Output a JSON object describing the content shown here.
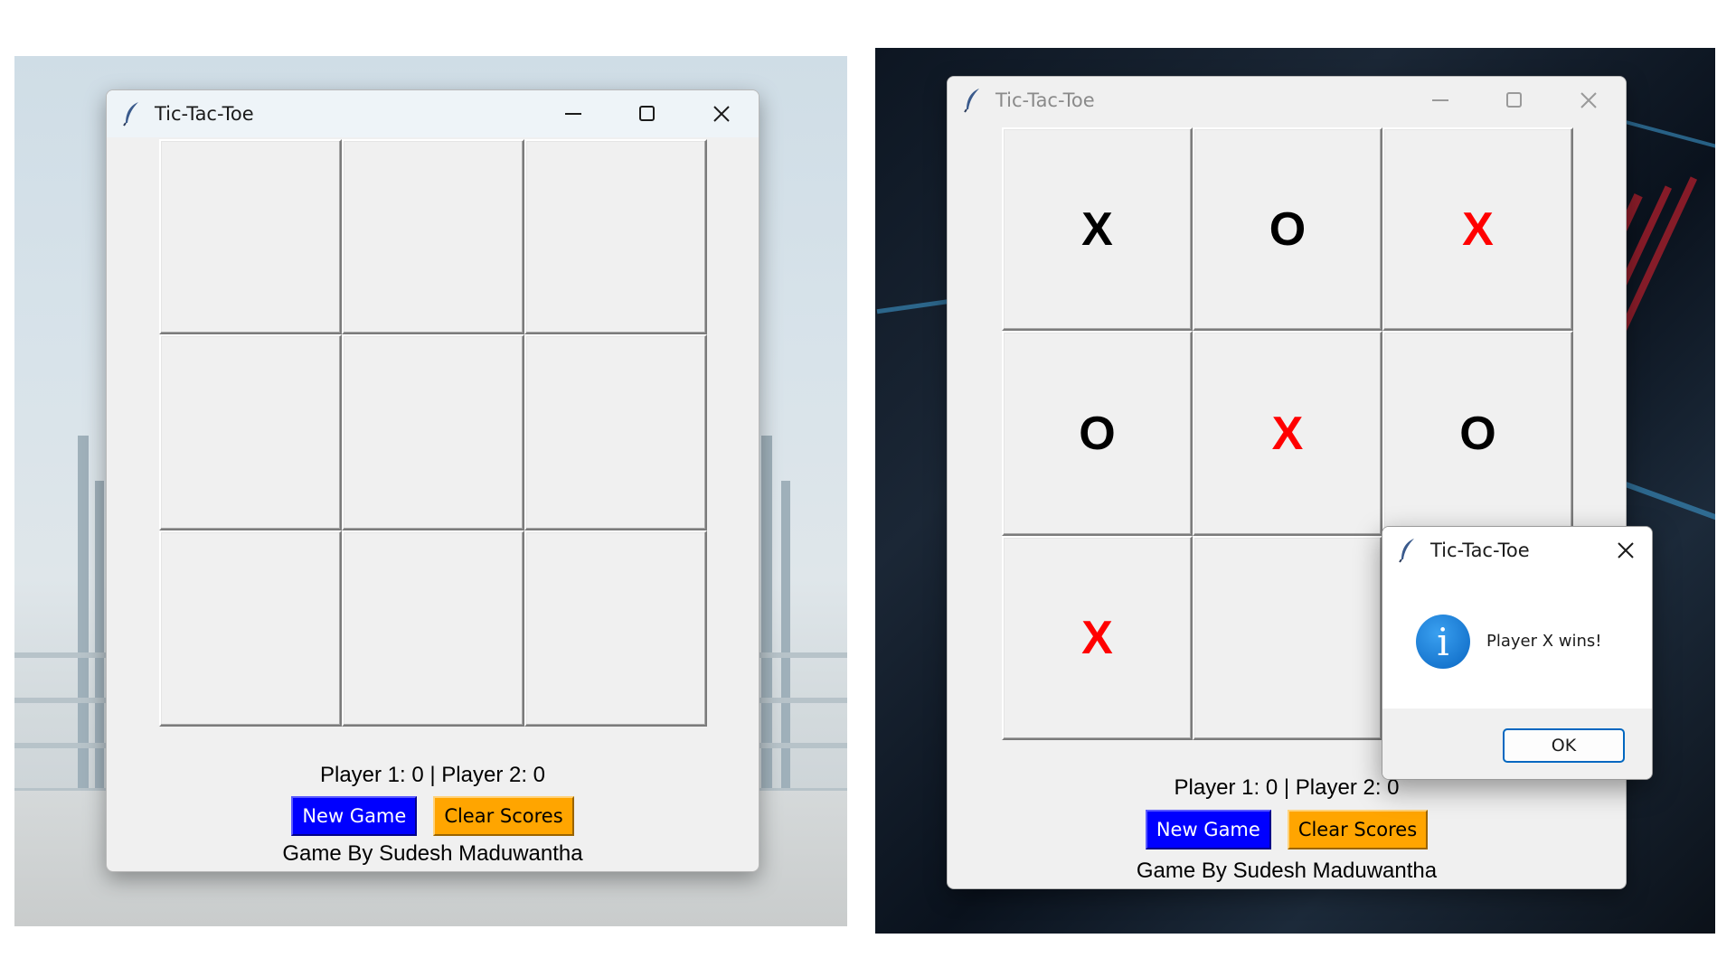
{
  "left_window": {
    "title": "Tic-Tac-Toe",
    "cells": [
      "",
      "",
      "",
      "",
      "",
      "",
      "",
      "",
      ""
    ],
    "score_text": "Player 1: 0 | Player 2: 0",
    "new_game_label": "New Game",
    "clear_scores_label": "Clear Scores",
    "credit": "Game By Sudesh Maduwantha",
    "icons": {
      "app": "feather-icon",
      "minimize": "minimize-icon",
      "maximize": "maximize-icon",
      "close": "close-icon"
    }
  },
  "right_window": {
    "title": "Tic-Tac-Toe",
    "cells": [
      {
        "mark": "X",
        "color": "#000000"
      },
      {
        "mark": "O",
        "color": "#000000"
      },
      {
        "mark": "X",
        "color": "#ff0000"
      },
      {
        "mark": "O",
        "color": "#000000"
      },
      {
        "mark": "X",
        "color": "#ff0000"
      },
      {
        "mark": "O",
        "color": "#000000"
      },
      {
        "mark": "X",
        "color": "#ff0000"
      },
      {
        "mark": "",
        "color": "#000000"
      },
      {
        "mark": "",
        "color": "#000000"
      }
    ],
    "score_text": "Player 1: 0 | Player 2: 0",
    "new_game_label": "New Game",
    "clear_scores_label": "Clear Scores",
    "credit": "Game By Sudesh Maduwantha"
  },
  "dialog": {
    "title": "Tic-Tac-Toe",
    "message": "Player X wins!",
    "ok_label": "OK",
    "icon": "info-icon",
    "info_glyph": "i"
  },
  "colors": {
    "new_game_bg": "#0000ff",
    "clear_scores_bg": "#ffa500",
    "win_mark": "#ff0000"
  }
}
